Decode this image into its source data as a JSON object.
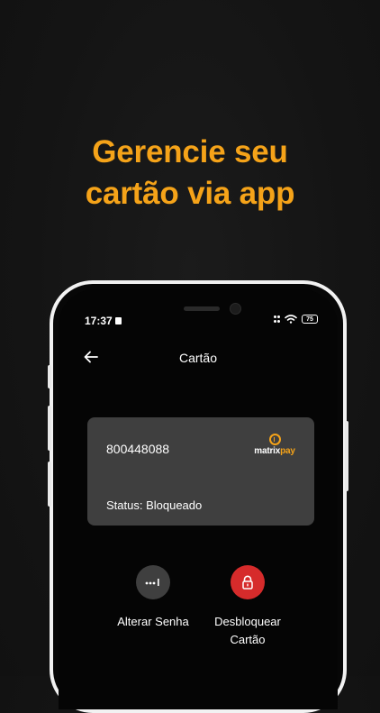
{
  "headline": {
    "line1": "Gerencie seu",
    "line2": "cartão via app"
  },
  "statusbar": {
    "time": "17:37",
    "battery": "75"
  },
  "header": {
    "title": "Cartão",
    "back_icon": "arrow-left-icon"
  },
  "card": {
    "number": "800448088",
    "status": "Status: Bloqueado",
    "brand_part1": "matrix",
    "brand_part2": "pay"
  },
  "actions": [
    {
      "label": "Alterar Senha",
      "icon": "password-dots-icon",
      "color": "#3f3f3f"
    },
    {
      "label_line1": "Desbloquear",
      "label_line2": "Cartão",
      "icon": "lock-icon",
      "color": "#d62b2b"
    }
  ],
  "colors": {
    "accent": "#f5a319",
    "danger": "#d62b2b",
    "card": "#3f3f3f",
    "background": "#141414"
  }
}
